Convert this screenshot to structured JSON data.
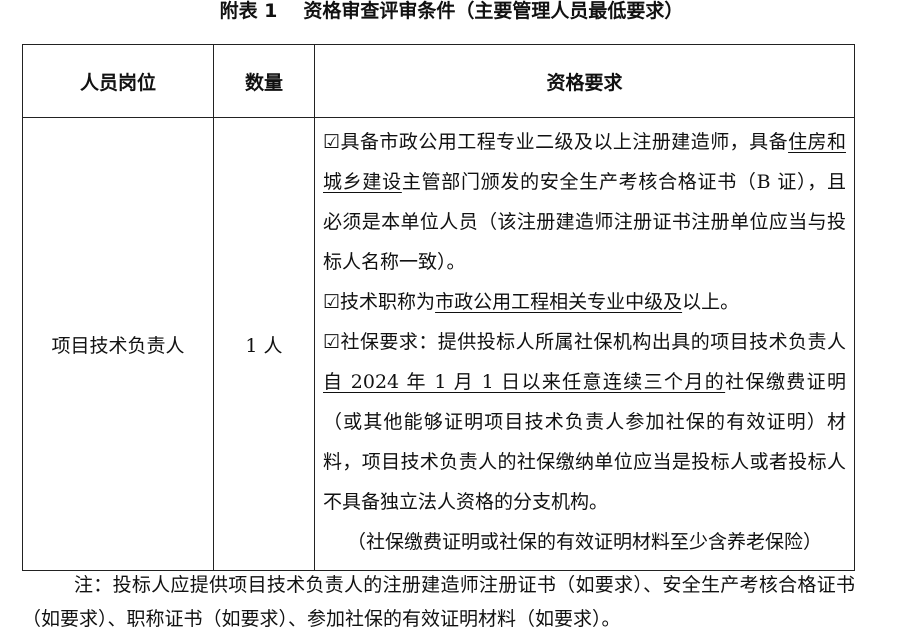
{
  "title": {
    "label": "附表 1",
    "text": "资格审查评审条件（主要管理人员最低要求）"
  },
  "table": {
    "headers": [
      "人员岗位",
      "数量",
      "资格要求"
    ],
    "row": {
      "position": "项目技术负责人",
      "quantity": "1 人",
      "requirements": {
        "item1": {
          "checkbox": "☑",
          "pre": "具备市政公用工程专业二级及以上注册建造师，具备",
          "underline": "住房和城乡建设",
          "post": "主管部门颁发的安全生产考核合格证书（B 证），且必须是本单位人员（该注册建造师注册证书注册单位应当与投标人名称一致）。"
        },
        "item2": {
          "checkbox": "☑",
          "pre": "技术职称为",
          "underline": "市政公用工程相关专业中级及",
          "post": "以上。"
        },
        "item3": {
          "checkbox": "☑",
          "pre": "社保要求：提供投标人所属社保机构出具的项目技术负责人",
          "underline": "自 2024 年 1 月 1 日以来任意连续三个月的",
          "post": "社保缴费证明（或其他能够证明项目技术负责人参加社保的有效证明）材料，项目技术负责人的社保缴纳单位应当是投标人或者投标人不具备独立法人资格的分支机构。"
        },
        "item3_note": "（社保缴费证明或社保的有效证明材料至少含养老保险）"
      }
    }
  },
  "note": "注：投标人应提供项目技术负责人的注册建造师注册证书（如要求）、安全生产考核合格证书（如要求）、职称证书（如要求）、参加社保的有效证明材料（如要求）。"
}
